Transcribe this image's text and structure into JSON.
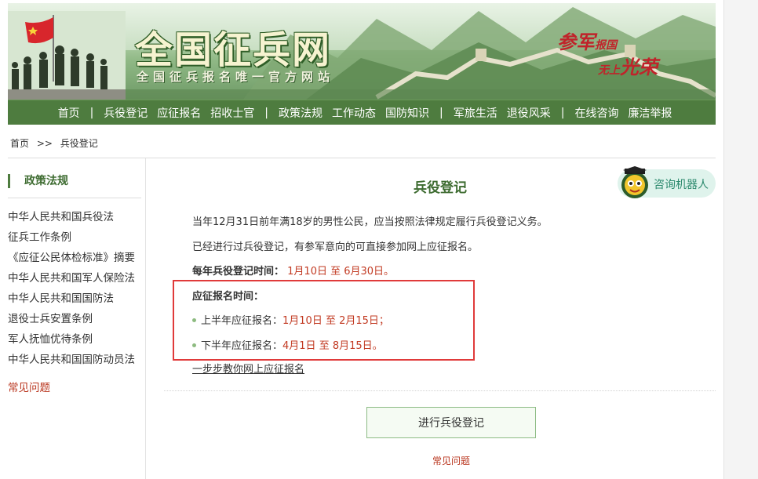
{
  "banner": {
    "logo": "全国征兵网",
    "tagline": "全国征兵报名唯一官方网站",
    "slogan_a_big": "参军",
    "slogan_a_small": "报国",
    "slogan_b_small": "无上",
    "slogan_b_big": "光荣"
  },
  "nav": {
    "items": [
      "首页",
      "兵役登记",
      "应征报名",
      "招收士官",
      "政策法规",
      "工作动态",
      "国防知识",
      "军旅生活",
      "退役风采",
      "在线咨询",
      "廉洁举报"
    ],
    "separator": "|"
  },
  "breadcrumb": {
    "home": "首页",
    "sep": ">>",
    "current": "兵役登记"
  },
  "sidebar": {
    "title": "政策法规",
    "items": [
      "中华人民共和国兵役法",
      "征兵工作条例",
      "《应征公民体检标准》摘要",
      "中华人民共和国军人保险法",
      "中华人民共和国国防法",
      "退役士兵安置条例",
      "军人抚恤优待条例",
      "中华人民共和国国防动员法"
    ],
    "faq": "常见问题"
  },
  "main": {
    "title": "兵役登记",
    "robot_label": "咨询机器人",
    "para1": "当年12月31日前年满18岁的男性公民，应当按照法律规定履行兵役登记义务。",
    "para2": "已经进行过兵役登记，有参军意向的可直接参加网上应征报名。",
    "reg_time_label": "每年兵役登记时间：",
    "reg_time_value": "1月10日 至 6月30日。",
    "enlist_label": "应征报名时间：",
    "first_half_label": "上半年应征报名：",
    "first_half_value": "1月10日 至 2月15日；",
    "second_half_label": "下半年应征报名：",
    "second_half_value": "4月1日 至 8月15日。",
    "guide_link": "一步步教你网上应征报名",
    "register_button": "进行兵役登记",
    "faq": "常见问题"
  },
  "colors": {
    "nav_green": "#4e7c3f",
    "title_green": "#3d6b30",
    "accent_red": "#c23a22",
    "highlight_border": "#e03a3a"
  }
}
